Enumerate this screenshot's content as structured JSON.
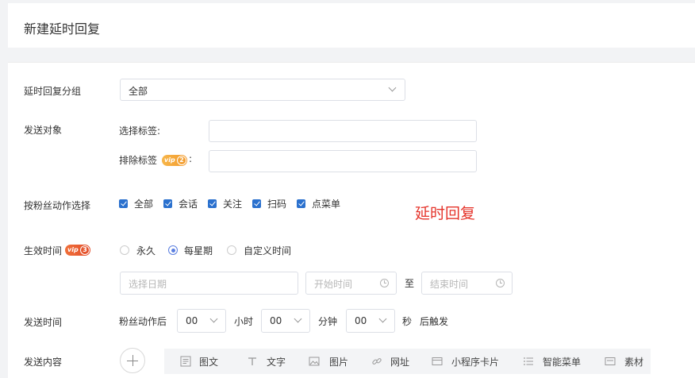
{
  "header": {
    "title": "新建延时回复"
  },
  "group": {
    "label": "延时回复分组",
    "value": "全部"
  },
  "target": {
    "label": "发送对象",
    "select_tags_label": "选择标签:",
    "exclude_tags_label": "排除标签",
    "exclude_vip_badge": "vip",
    "exclude_vip_level": "2",
    "colon": ":",
    "select_tags_value": "",
    "exclude_tags_value": ""
  },
  "actions": {
    "label": "按粉丝动作选择",
    "options": [
      {
        "label": "全部",
        "checked": true
      },
      {
        "label": "会话",
        "checked": true
      },
      {
        "label": "关注",
        "checked": true
      },
      {
        "label": "扫码",
        "checked": true
      },
      {
        "label": "点菜单",
        "checked": true
      }
    ]
  },
  "watermark": {
    "text": "延时回复",
    "color": "#e5332a"
  },
  "effective": {
    "label": "生效时间",
    "vip_badge": "vip",
    "vip_level": "3",
    "options": [
      {
        "label": "永久",
        "selected": false
      },
      {
        "label": "每星期",
        "selected": true
      },
      {
        "label": "自定义时间",
        "selected": false
      }
    ],
    "date_placeholder": "选择日期",
    "start_placeholder": "开始时间",
    "to_label": "至",
    "end_placeholder": "结束时间"
  },
  "send_time": {
    "label": "发送时间",
    "prefix": "粉丝动作后",
    "hours_value": "00",
    "hours_unit": "小时",
    "minutes_value": "00",
    "minutes_unit": "分钟",
    "seconds_value": "00",
    "seconds_unit": "秒",
    "suffix": "后触发"
  },
  "content": {
    "label": "发送内容",
    "tools": [
      {
        "label": "图文",
        "icon": "news-icon"
      },
      {
        "label": "文字",
        "icon": "text-icon"
      },
      {
        "label": "图片",
        "icon": "image-icon"
      },
      {
        "label": "网址",
        "icon": "link-icon"
      },
      {
        "label": "小程序卡片",
        "icon": "miniprogram-card-icon"
      },
      {
        "label": "智能菜单",
        "icon": "smart-menu-icon"
      },
      {
        "label": "素材",
        "icon": "material-icon"
      }
    ]
  },
  "colors": {
    "accent": "#2b71ce",
    "radio": "#5b7fe0",
    "vip_orange": "#f39a2c",
    "vip_red": "#e24d2b"
  }
}
